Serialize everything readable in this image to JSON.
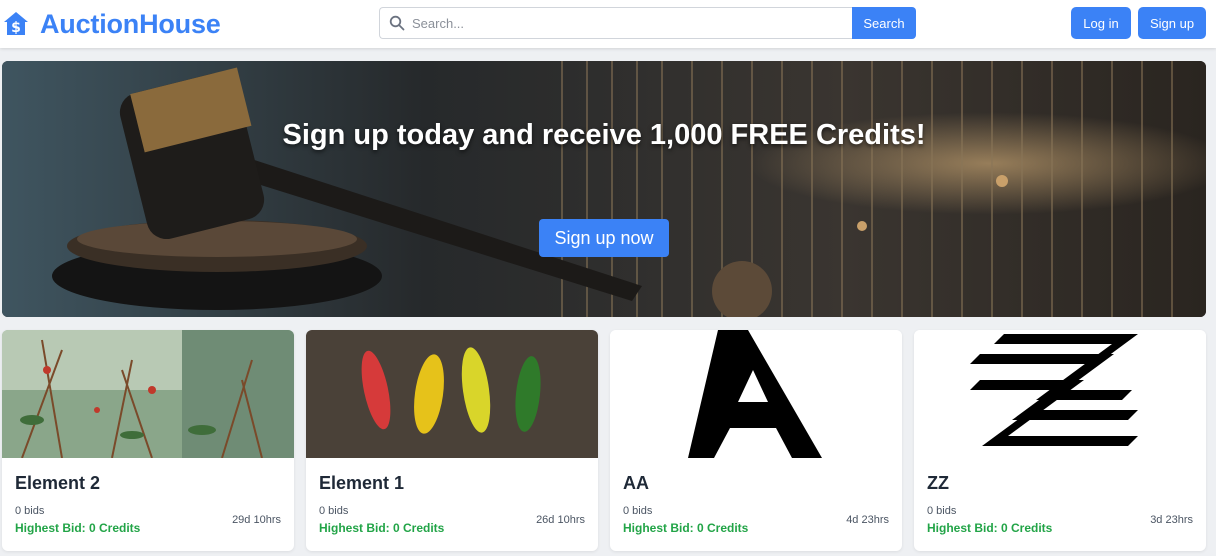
{
  "header": {
    "brand_name": "AuctionHouse",
    "search_placeholder": "Search...",
    "search_button": "Search",
    "login_button": "Log in",
    "signup_button": "Sign up"
  },
  "hero": {
    "headline": "Sign up today and receive 1,000 FREE Credits!",
    "cta_button": "Sign up now"
  },
  "listings": [
    {
      "title": "Element 2",
      "bids": "0 bids",
      "highest_bid": "Highest Bid: 0 Credits",
      "time_left": "29d 10hrs",
      "image": "spider-web-plants-photo"
    },
    {
      "title": "Element 1",
      "bids": "0 bids",
      "highest_bid": "Highest Bid: 0 Credits",
      "time_left": "26d 10hrs",
      "image": "colored-leaves-photo"
    },
    {
      "title": "AA",
      "bids": "0 bids",
      "highest_bid": "Highest Bid: 0 Credits",
      "time_left": "4d 23hrs",
      "image": "letter-a-image"
    },
    {
      "title": "ZZ",
      "bids": "0 bids",
      "highest_bid": "Highest Bid: 0 Credits",
      "time_left": "3d 23hrs",
      "image": "letter-z-logo-image"
    }
  ],
  "colors": {
    "brand": "#3b82f6",
    "highest_bid": "#22a447",
    "page_bg": "#eef0f3"
  }
}
